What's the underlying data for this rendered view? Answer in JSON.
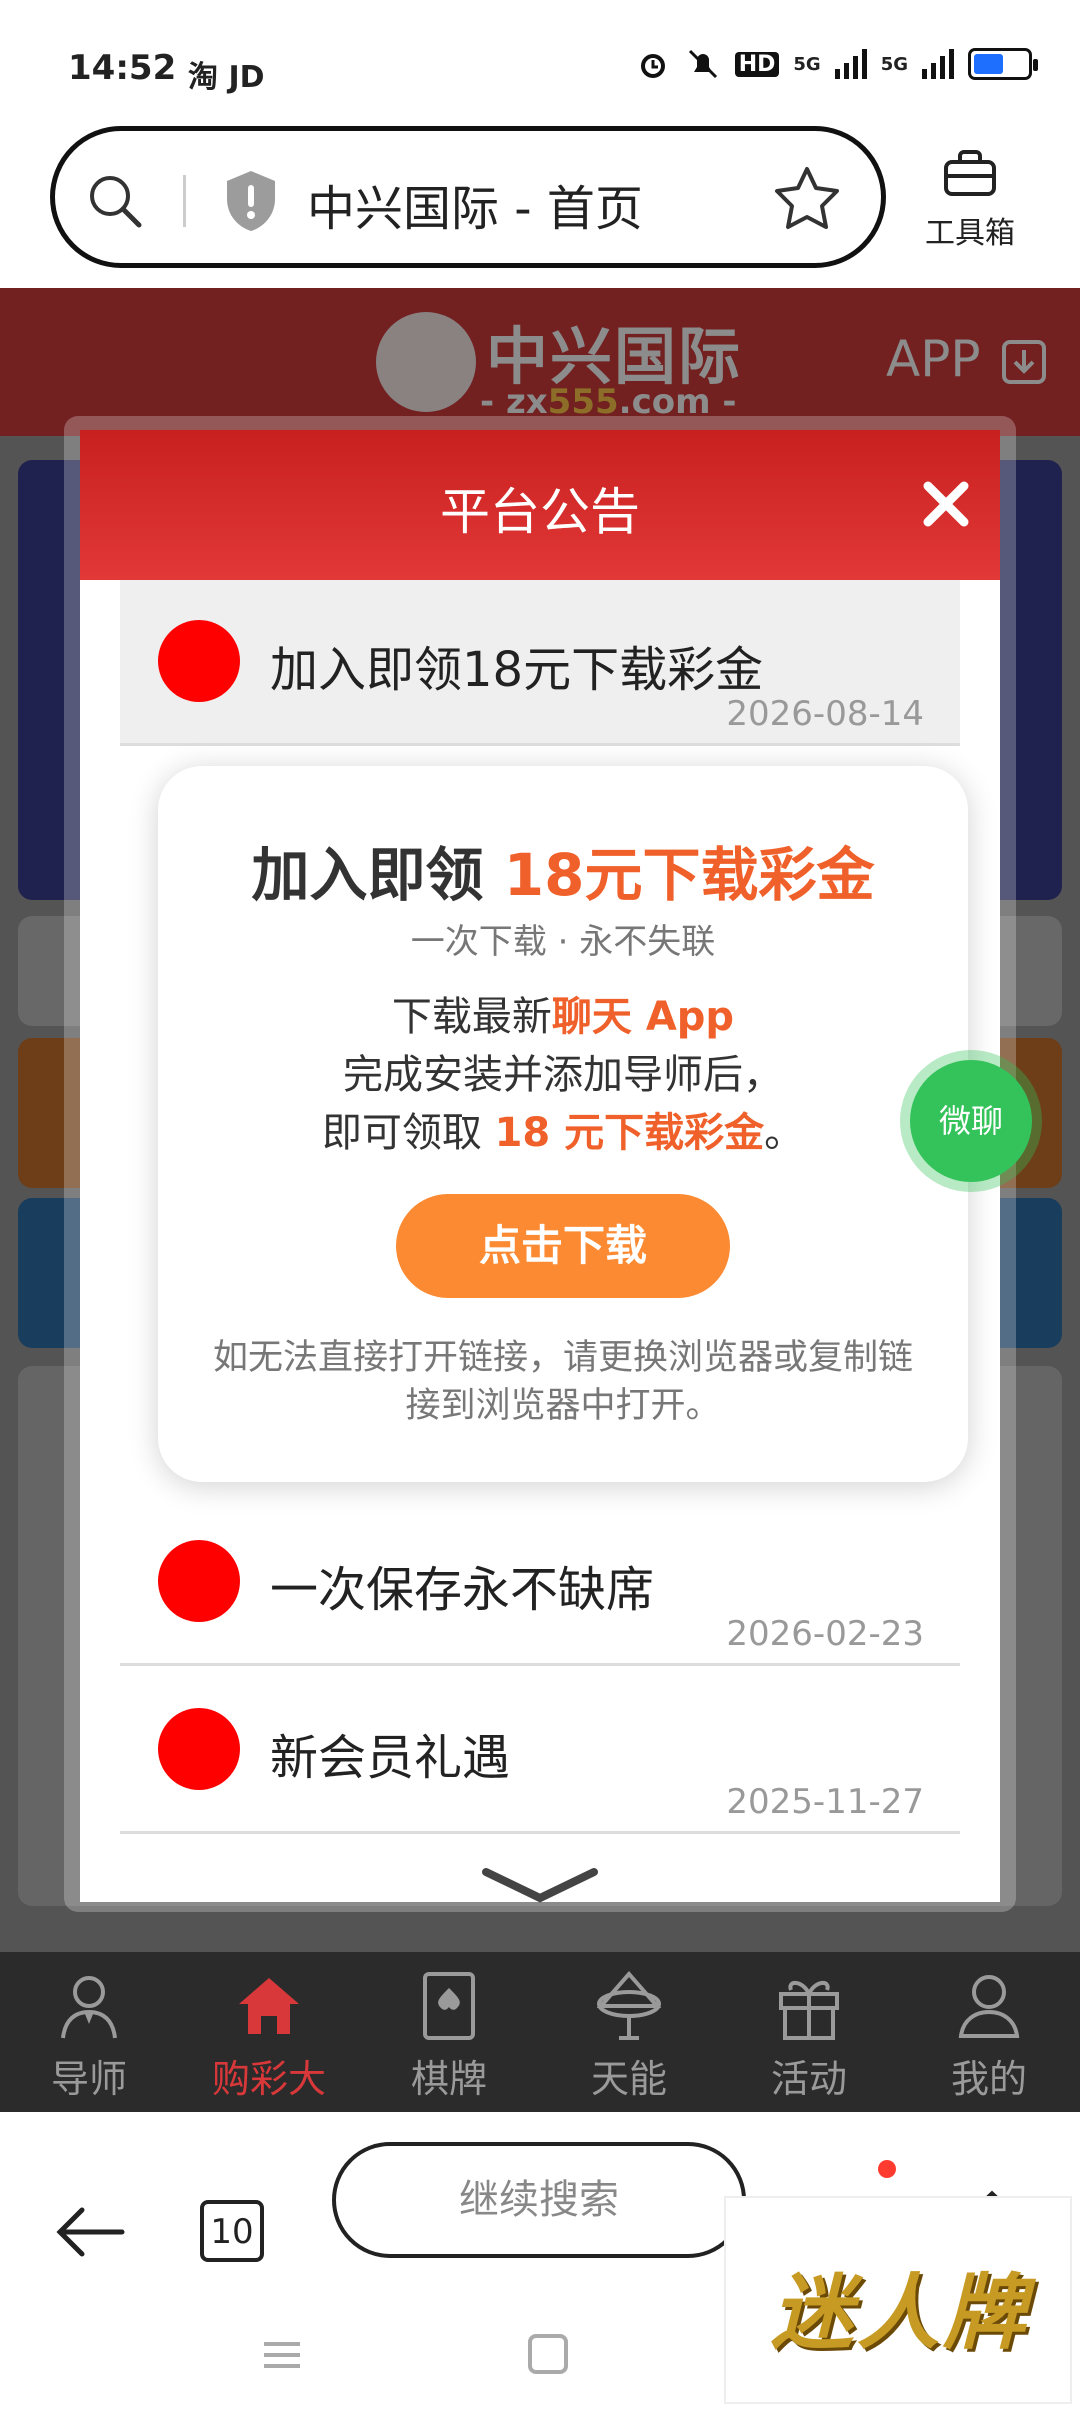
{
  "status_bar": {
    "time": "14:52",
    "apps": "淘 JD",
    "network": "5G",
    "hd": "HD"
  },
  "address_bar": {
    "title": "中兴国际 - 首页"
  },
  "toolbox": {
    "label": "工具箱"
  },
  "site_header": {
    "logo_text": "中兴国际",
    "logo_sub_prefix": "- zx",
    "logo_sub_num": "555",
    "logo_sub_suffix": ".com -",
    "app_label": "APP"
  },
  "modal": {
    "title": "平台公告",
    "notices": [
      {
        "title": "加入即领18元下载彩金",
        "date": "2026-08-14"
      },
      {
        "title": "一次保存永不缺席",
        "date": "2026-02-23"
      },
      {
        "title": "新会员礼遇",
        "date": "2025-11-27"
      }
    ]
  },
  "popup": {
    "heading_plain": "加入即领 ",
    "heading_highlight": "18元下载彩金",
    "subtitle": "一次下载 · 永不失联",
    "line1_plain": "下载最新",
    "line1_highlight": "聊天 App",
    "line2": "完成安装并添加导师后，",
    "line3_plain": "即可领取 ",
    "line3_highlight": "18 元下载彩金",
    "line3_end": "。",
    "button": "点击下载",
    "note": "如无法直接打开链接，请更换浏览器或复制链接到浏览器中打开。"
  },
  "wechat_bubble": "微聊",
  "site_nav": [
    {
      "label": "导师",
      "icon": "mentor-icon"
    },
    {
      "label": "购彩大厅",
      "icon": "home-icon",
      "active": true
    },
    {
      "label": "棋牌",
      "icon": "cards-icon"
    },
    {
      "label": "天能",
      "icon": "tn-icon"
    },
    {
      "label": "活动",
      "icon": "gift-icon"
    },
    {
      "label": "我的",
      "icon": "user-icon"
    }
  ],
  "browser_bar": {
    "tab_count": "10",
    "continue_search": "继续搜索"
  },
  "watermark": "迷人牌",
  "colors": {
    "site_red": "#cf3b3b",
    "modal_red": "#d82a2a",
    "highlight_orange": "#f0602a",
    "button_orange": "#fb8a32",
    "nav_active": "#d9383a",
    "wechat_green": "#34c35a"
  }
}
